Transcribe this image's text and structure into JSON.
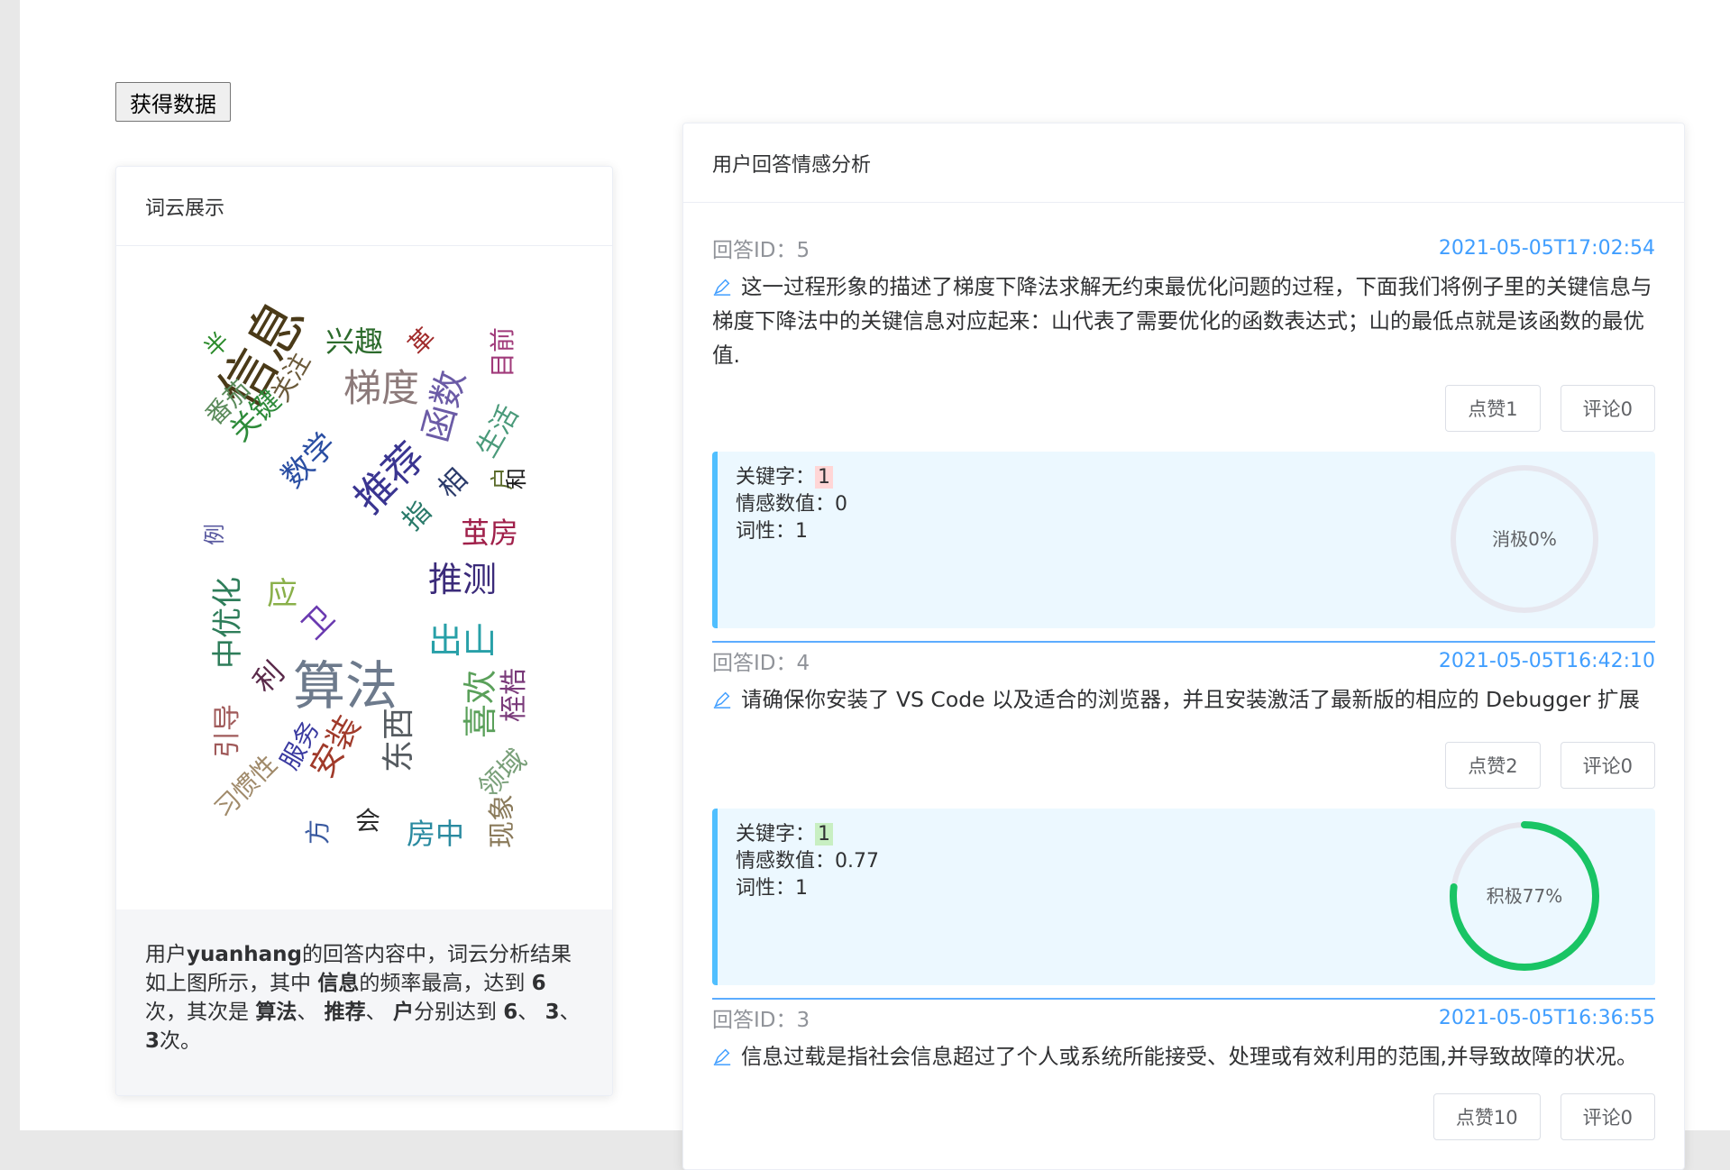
{
  "toolbar": {
    "fetch_label": "获得数据"
  },
  "wordcloud": {
    "title": "词云展示",
    "words": [
      {
        "text": "信息",
        "color": "#4a3a18",
        "rot": -60
      },
      {
        "text": "算法",
        "color": "#6d7a8c",
        "rot": 0
      },
      {
        "text": "推荐",
        "color": "#3a3591",
        "rot": -45
      },
      {
        "text": "梯度",
        "color": "#8c7a7a",
        "rot": 0
      },
      {
        "text": "函数",
        "color": "#6b5ba6",
        "rot": -75
      },
      {
        "text": "推测",
        "color": "#3b2b7a",
        "rot": 0
      },
      {
        "text": "出山",
        "color": "#28a0a8",
        "rot": 0
      },
      {
        "text": "喜欢",
        "color": "#5aa05a",
        "rot": -90
      },
      {
        "text": "东西",
        "color": "#555b60",
        "rot": -90
      },
      {
        "text": "安装",
        "color": "#a03a2a",
        "rot": -60
      },
      {
        "text": "中优化",
        "color": "#2e7d5a",
        "rot": -90
      },
      {
        "text": "数学",
        "color": "#2b4fa3",
        "rot": -45
      },
      {
        "text": "关键",
        "color": "#2e8b3a",
        "rot": -45
      },
      {
        "text": "番茄",
        "color": "#5a8a5a",
        "rot": -45
      },
      {
        "text": "兴趣",
        "color": "#2c6b2c",
        "rot": 0
      },
      {
        "text": "关注",
        "color": "#6b5a3a",
        "rot": -60
      },
      {
        "text": "生活",
        "color": "#4a9a7a",
        "rot": -60
      },
      {
        "text": "目前",
        "color": "#a03a7a",
        "rot": -90
      },
      {
        "text": "茧房",
        "color": "#a0204a",
        "rot": 0
      },
      {
        "text": "相",
        "color": "#2a3a6a",
        "rot": -45
      },
      {
        "text": "指",
        "color": "#2a7a6a",
        "rot": -45
      },
      {
        "text": "户",
        "color": "#5a6a2a",
        "rot": -90
      },
      {
        "text": "应",
        "color": "#8ab04a",
        "rot": 0
      },
      {
        "text": "卫",
        "color": "#6a3ab0",
        "rot": -45
      },
      {
        "text": "利",
        "color": "#5a2a4a",
        "rot": -45
      },
      {
        "text": "引导",
        "color": "#a05a5a",
        "rot": -90
      },
      {
        "text": "服务",
        "color": "#3a3aa0",
        "rot": -60
      },
      {
        "text": "桎梏",
        "color": "#7a3a7a",
        "rot": -90
      },
      {
        "text": "领域",
        "color": "#7aa07a",
        "rot": -45
      },
      {
        "text": "习惯性",
        "color": "#a08a6a",
        "rot": -45
      },
      {
        "text": "方",
        "color": "#3a5aa0",
        "rot": -90
      },
      {
        "text": "会",
        "color": "#2a2a2a",
        "rot": 0
      },
      {
        "text": "房中",
        "color": "#2a8aa0",
        "rot": 0
      },
      {
        "text": "现象",
        "color": "#8a7a5a",
        "rot": -90
      },
      {
        "text": "例",
        "color": "#5a5aa0",
        "rot": -90
      },
      {
        "text": "半",
        "color": "#2a8a2a",
        "rot": -45
      },
      {
        "text": "革",
        "color": "#a02a2a",
        "rot": -45
      },
      {
        "text": "和",
        "color": "#1a1a1a",
        "rot": -90
      }
    ],
    "summary": {
      "p1": "用户",
      "user": "yuanhang",
      "p2": "的回答内容中，词云分析结果如上图所示，其中 ",
      "top_word": "信息",
      "p3": "的频率最高，达到 ",
      "top_count": "6",
      "p4": "次，其次是 ",
      "w2": "算法",
      "sep1": "、 ",
      "w3": "推荐",
      "sep2": "、 ",
      "w4": "户",
      "p5": "分别达到 ",
      "c2": "6",
      "sep3": "、 ",
      "c3": "3",
      "sep4": "、 ",
      "c4": "3",
      "p6": "次。"
    }
  },
  "analysis": {
    "title": "用户回答情感分析",
    "answers": [
      {
        "id_label": "回答ID：5",
        "time": "2021-05-05T17:02:54",
        "text": "这一过程形象的描述了梯度下降法求解无约束最优化问题的过程，下面我们将例子里的关键信息与梯度下降法中的关键信息对应起来：山代表了需要优化的函数表达式；山的最低点就是该函数的最优值.",
        "like_label": "点赞1",
        "comment_label": "评论0",
        "keyword_label": "关键字：",
        "keyword": "1",
        "score_label": "情感数值：",
        "score": "0",
        "pos_label": "词性：",
        "pos": "1",
        "ring_label": "消极0%",
        "ring_value": 0,
        "ring_color": "#e6e6ee",
        "sentiment": "negative"
      },
      {
        "id_label": "回答ID：4",
        "time": "2021-05-05T16:42:10",
        "text": "请确保你安装了 VS Code 以及适合的浏览器，并且安装激活了最新版的相应的 Debugger 扩展",
        "like_label": "点赞2",
        "comment_label": "评论0",
        "keyword_label": "关键字：",
        "keyword": "1",
        "score_label": "情感数值：",
        "score": "0.77",
        "pos_label": "词性：",
        "pos": "1",
        "ring_label": "积极77%",
        "ring_value": 0.77,
        "ring_color": "#19c464",
        "sentiment": "positive"
      },
      {
        "id_label": "回答ID：3",
        "time": "2021-05-05T16:36:55",
        "text": "信息过载是指社会信息超过了个人或系统所能接受、处理或有效利用的范围,并导致故障的状况。",
        "like_label": "点赞10",
        "comment_label": "评论0"
      }
    ]
  },
  "colors": {
    "accent": "#409eff",
    "info_border": "#50bfff",
    "info_bg": "#ecf8ff",
    "positive": "#19c464"
  }
}
